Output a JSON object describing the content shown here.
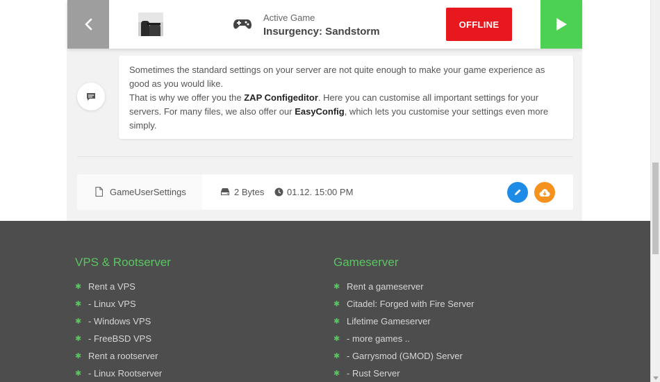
{
  "server_bar": {
    "active_label": "Active Game",
    "game_name": "Insurgency: Sandstorm",
    "status_button": "OFFLINE"
  },
  "info": {
    "line1": "Sometimes the standard settings on your server are not quite enough to make your game experience as good as you would like.",
    "line2_pre": "That is why we offer you the ",
    "line2_bold": "ZAP Configeditor",
    "line2_post": ". Here you can customise all important settings for your servers. For many files, we also offer our ",
    "line2_bold2": "EasyConfig",
    "line2_end": ", which lets you customise your settings even more simply."
  },
  "file": {
    "name": "GameUserSettings",
    "size": "2 Bytes",
    "modified": "01.12. 15:00 PM"
  },
  "footer": {
    "col1": {
      "heading": "VPS & Rootserver",
      "items": [
        "Rent a VPS",
        "- Linux VPS",
        "- Windows VPS",
        "- FreeBSD VPS",
        "Rent a rootserver",
        "- Linux Rootserver"
      ]
    },
    "col2": {
      "heading": "Gameserver",
      "items": [
        "Rent a gameserver",
        "Citadel: Forged with Fire Server",
        "Lifetime Gameserver",
        "- more games ..",
        "- Garrysmod (GMOD) Server",
        "- Rust Server"
      ]
    }
  },
  "colors": {
    "offline": "#e8191e",
    "play": "#4cd152",
    "edit": "#1e8be6",
    "download": "#f5921e",
    "footer_bg": "#4d4d4d",
    "footer_accent": "#5cc463"
  }
}
